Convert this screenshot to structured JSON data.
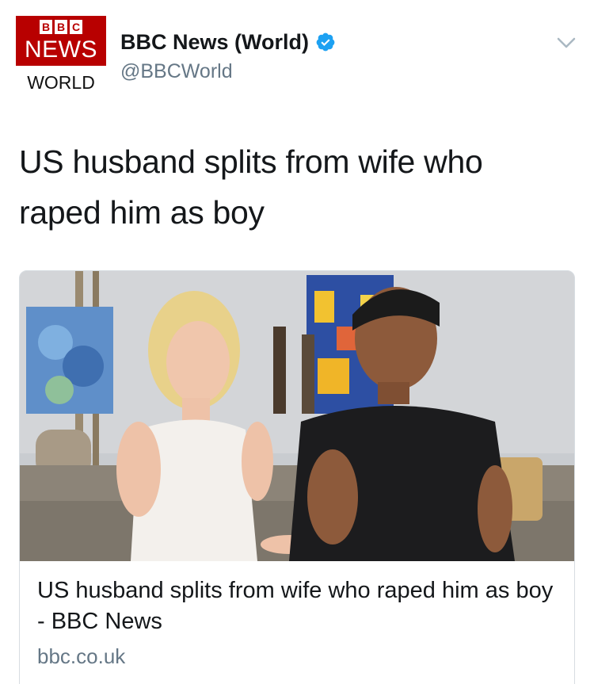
{
  "account": {
    "logo_blocks": [
      "B",
      "B",
      "C"
    ],
    "logo_news": "NEWS",
    "logo_world": "WORLD",
    "name": "BBC News (World)",
    "handle": "@BBCWorld",
    "verified": true
  },
  "tweet": {
    "text": "US husband splits from wife who raped him as boy"
  },
  "card": {
    "title": "US husband splits from wife who raped him as boy - BBC News",
    "domain": "bbc.co.uk"
  },
  "colors": {
    "bbc_red": "#b80000",
    "verified_blue": "#1da1f2",
    "secondary_text": "#657786"
  },
  "icons": {
    "verified": "verified-badge-icon",
    "menu": "chevron-down-icon"
  }
}
